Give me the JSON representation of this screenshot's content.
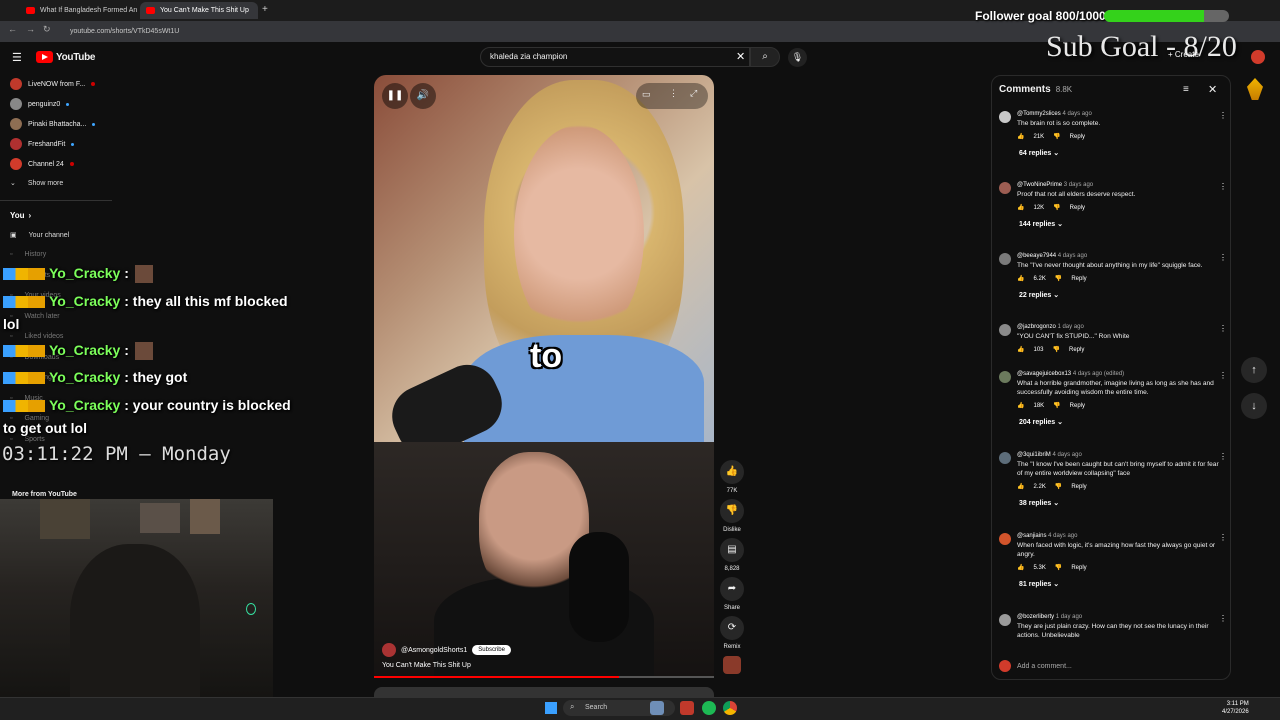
{
  "browser": {
    "tabs": [
      {
        "title": "What If Bangladesh Formed An"
      },
      {
        "title": "You Can't Make This Shit Up"
      }
    ],
    "url": "youtube.com/shorts/VTkD45sWt1U"
  },
  "youtube": {
    "logo": "YouTube",
    "search_value": "khaleda zia champion"
  },
  "overlay": {
    "follower_goal": "Follower goal 800/1000",
    "follower_progress": 0.8,
    "sub_goal": "Sub Goal - 8/20",
    "clock": "03:11:22 PM – Monday",
    "kick_count": "4"
  },
  "sidebar": {
    "subscriptions": [
      {
        "name": "LiveNOW from F...",
        "color": "#c0392b"
      },
      {
        "name": "penguinz0",
        "color": "#888888"
      },
      {
        "name": "Pinaki Bhattacha...",
        "color": "#8e6e53"
      },
      {
        "name": "FreshandFit",
        "color": "#b03030"
      },
      {
        "name": "Channel 24",
        "color": "#d13b2b"
      }
    ],
    "show_more": "Show more",
    "you": "You",
    "your_channel": "Your channel",
    "nav": [
      "History",
      "Playlists",
      "Your videos",
      "Watch later",
      "Liked videos",
      "Downloads",
      "Trending",
      "Music",
      "Gaming",
      "Sports"
    ],
    "more_from": "More from YouTube"
  },
  "chat": [
    {
      "name": "Yo_Cracky",
      "text": ":"
    },
    {
      "name": "Yo_Cracky",
      "text": ": they all this mf blocked"
    },
    {
      "name": "",
      "text": "lol"
    },
    {
      "name": "Yo_Cracky",
      "text": ":"
    },
    {
      "name": "Yo_Cracky",
      "text": ": they got"
    },
    {
      "name": "Yo_Cracky",
      "text": ": your country is blocked"
    },
    {
      "name": "",
      "text": "to get out lol"
    }
  ],
  "video": {
    "caption": "to",
    "channel": "@AsmongoldShorts1",
    "subscribe": "Subscribe",
    "title": "You Can't Make This Shit Up",
    "progress": 0.72
  },
  "actions": [
    {
      "icon": "like-icon",
      "label": "77K"
    },
    {
      "icon": "dislike-icon",
      "label": "Dislike"
    },
    {
      "icon": "comment-icon",
      "label": "8,828"
    },
    {
      "icon": "share-icon",
      "label": "Share"
    },
    {
      "icon": "remix-icon",
      "label": "Remix"
    }
  ],
  "comments_panel": {
    "title": "Comments",
    "count": "8.8K",
    "add_placeholder": "Add a comment...",
    "items": [
      {
        "user": "@Tommy2slices",
        "time": "4 days ago",
        "text": "The brain rot is so complete.",
        "likes": "21K",
        "replies": "64 replies",
        "color": "#c9c9c9"
      },
      {
        "user": "@TwoNinePrime",
        "time": "3 days ago",
        "text": "Proof that not all elders deserve respect.",
        "likes": "12K",
        "replies": "144 replies",
        "color": "#9c5d52"
      },
      {
        "user": "@beeaye7944",
        "time": "4 days ago",
        "text": "The \"I've never thought about anything in my life\" squiggle face.",
        "likes": "6.2K",
        "replies": "22 replies",
        "color": "#7a7a7a"
      },
      {
        "user": "@jazbrogonzo",
        "time": "1 day ago",
        "text": "\"YOU CAN'T fix STUPID...\" Ron White",
        "likes": "103",
        "replies": "",
        "color": "#8a8a8a"
      },
      {
        "user": "@savagejuicebox13",
        "time": "4 days ago (edited)",
        "text": "What a horrible grandmother, imagine living as long as she has and successfully avoiding wisdom the entire time.",
        "likes": "18K",
        "replies": "204 replies",
        "color": "#6b7a5d"
      },
      {
        "user": "@3qui1ibriM",
        "time": "4 days ago",
        "text": "The \"I know I've been caught but can't bring myself to admit it for fear of my entire worldview collapsing\" face",
        "likes": "2.2K",
        "replies": "38 replies",
        "color": "#5d6d7a"
      },
      {
        "user": "@sanjiains",
        "time": "4 days ago",
        "text": "When faced with logic, it's amazing how fast they always go quiet or angry.",
        "likes": "5.3K",
        "replies": "81 replies",
        "color": "#d2542b"
      },
      {
        "user": "@bozerliberty",
        "time": "1 day ago",
        "text": "They are just plain crazy. How can they not see the lunacy in their actions. Unbelievable",
        "likes": "",
        "replies": "",
        "color": "#9a9a9a"
      }
    ],
    "reply_label": "Reply"
  },
  "taskbar": {
    "search": "Search",
    "time": "3:11 PM",
    "date": "4/27/2026"
  }
}
